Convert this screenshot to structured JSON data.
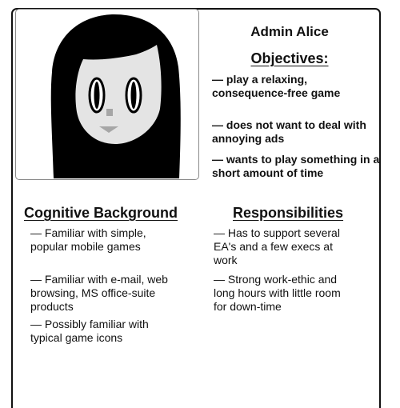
{
  "persona": {
    "name": "Admin Alice",
    "objectives": {
      "heading": "Objectives:",
      "items": [
        "— play a relaxing, consequence-free game",
        "— does not want to deal with annoying ads",
        "— wants to play something in a short amount of time"
      ]
    },
    "cognitive_background": {
      "heading": "Cognitive Background",
      "items": [
        "— Familiar with simple, popular mobile games",
        "— Familiar with e-mail, web browsing, MS office-suite products",
        "— Possibly familiar with typical game icons"
      ]
    },
    "responsibilities": {
      "heading": "Responsibilities",
      "items": [
        "— Has to support several EA's and a few execs at work",
        "— Strong work-ethic and long hours with little room for down-time"
      ]
    }
  },
  "colors": {
    "hair": "#000000",
    "skin": "#e4e4e4",
    "nose": "#a6a6a6",
    "frame_border": "#8a8a8a"
  },
  "icons": {
    "avatar": "female-persona-avatar-illustration"
  }
}
